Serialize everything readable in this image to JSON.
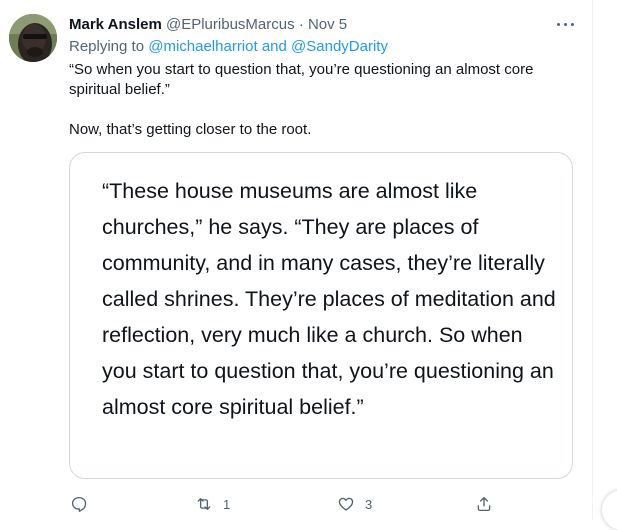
{
  "tweet": {
    "display_name": "Mark Anslem",
    "handle": "@EPluribusMarcus",
    "separator": "·",
    "date": "Nov 5",
    "replying_prefix": "Replying to",
    "replying_to_1": "@michaelharriot",
    "replying_and": "and",
    "replying_to_2": "@SandyDarity",
    "text_paragraph_1": "“So when you start to question that, you’re questioning an almost core spiritual belief.”",
    "text_paragraph_2": "Now, that’s getting closer to the root.",
    "quote_image_text": "“These house museums are almost like churches,” he says. “They are places of community, and in many cases, they’re literally called shrines. They’re places of meditation and reflection, very much like a church. So when you start to question that, you’re questioning an almost core spiritual belief.”",
    "actions": {
      "reply_count": "",
      "retweet_count": "1",
      "like_count": "3"
    }
  },
  "icons": {
    "more": "more-horizontal-icon",
    "reply": "reply-icon",
    "retweet": "retweet-icon",
    "like": "heart-icon",
    "share": "share-icon"
  },
  "colors": {
    "accent": "#1d9bf0",
    "muted": "#536471",
    "text": "#0f1419",
    "border": "#cfd9de"
  }
}
